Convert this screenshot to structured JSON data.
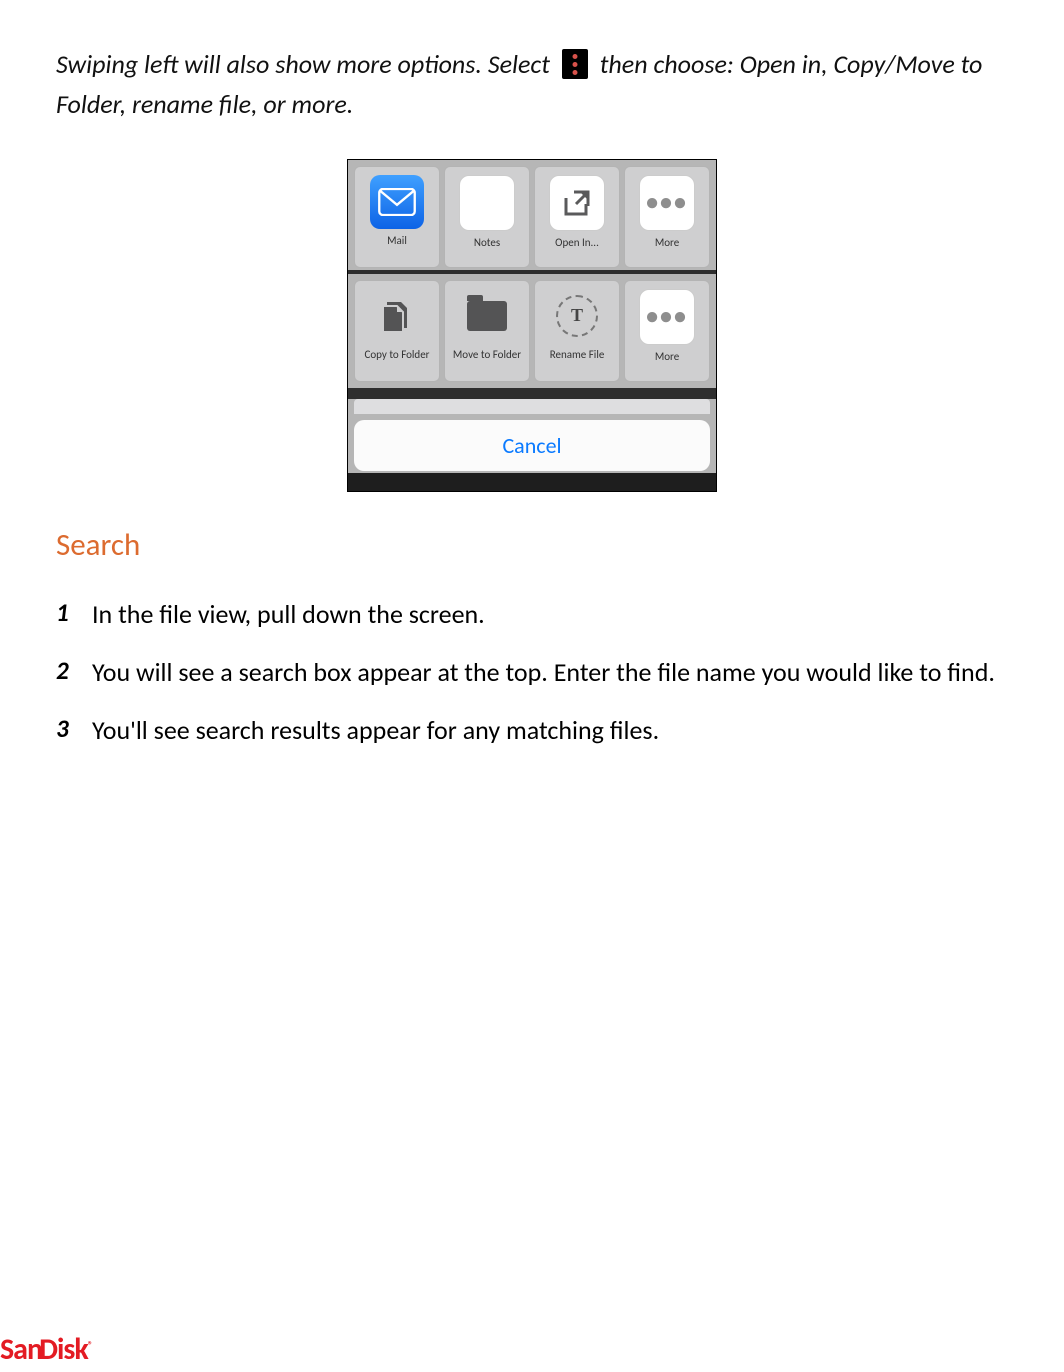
{
  "intro": {
    "part1": "Swiping left will also show more options. Select",
    "part2": "then choose: Open in, Copy/Move to Folder, rename file, or more."
  },
  "share_sheet": {
    "row1": [
      {
        "label": "Mail"
      },
      {
        "label": "Notes"
      },
      {
        "label": "Open In..."
      },
      {
        "label": "More"
      }
    ],
    "row2": [
      {
        "label": "Copy to Folder"
      },
      {
        "label": "Move to Folder"
      },
      {
        "label": "Rename File"
      },
      {
        "label": "More"
      }
    ],
    "rename_letter": "T",
    "more_dots": "•••",
    "cancel": "Cancel"
  },
  "section_heading": "Search",
  "steps": [
    "In the file view, pull down the screen.",
    "You will see a search box appear at the top. Enter the file name you would like to find.",
    "You'll see search results appear for any matching files."
  ],
  "brand": "SanDisk"
}
